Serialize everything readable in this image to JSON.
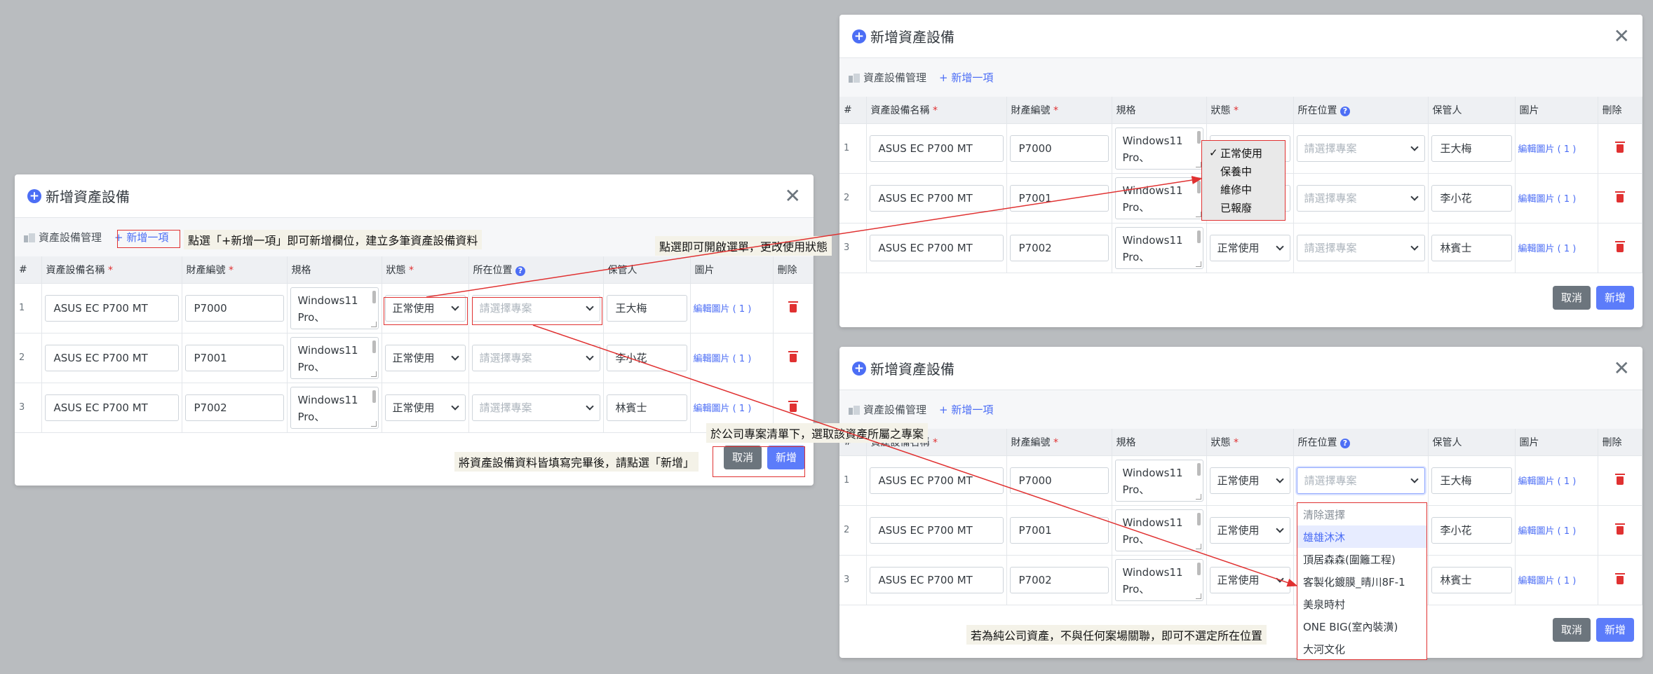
{
  "dialog": {
    "title": "新增資產設備",
    "breadcrumb": "資產設備管理",
    "add_item": "+ 新增一項",
    "columns": {
      "idx": "#",
      "name": "資產設備名稱",
      "code": "財產編號",
      "spec": "規格",
      "status": "狀態",
      "location": "所在位置",
      "keeper": "保管人",
      "image": "圖片",
      "delete": "刪除"
    },
    "required_mark": "*",
    "help_icon_glyph": "?",
    "location_placeholder": "請選擇專案",
    "rows": [
      {
        "idx": "1",
        "name": "ASUS EC P700 MT",
        "code": "P7000",
        "spec_line1": "Windows11",
        "spec_line2": "Pro、",
        "status": "正常使用",
        "keeper": "王大梅",
        "image": "編輯圖片 ( 1 )"
      },
      {
        "idx": "2",
        "name": "ASUS EC P700 MT",
        "code": "P7001",
        "spec_line1": "Windows11",
        "spec_line2": "Pro、",
        "status": "正常使用",
        "keeper": "李小花",
        "image": "編輯圖片 ( 1 )"
      },
      {
        "idx": "3",
        "name": "ASUS EC P700 MT",
        "code": "P7002",
        "spec_line1": "Windows11",
        "spec_line2": "Pro、",
        "status": "正常使用",
        "keeper": "林賓士",
        "image": "編輯圖片 ( 1 )"
      }
    ],
    "cancel_label": "取消",
    "submit_label": "新增"
  },
  "status_options": [
    "正常使用",
    "保養中",
    "維修中",
    "已報廢"
  ],
  "status_check": "✓",
  "location_options": [
    "清除選擇",
    "雄雄沐沐",
    "頂居森森(圍籬工程)",
    "客製化鍍膜_晴川8F-1",
    "美泉時村",
    "ONE BIG(室內裝潢)",
    "大河文化"
  ],
  "callouts": {
    "add_item": "點選「+新增一項」即可新增欄位，建立多筆資產設備資料",
    "status": "點選即可開啟選單，更改使用狀態",
    "location": "於公司專案清單下，選取該資產所屬之專案",
    "submit": "將資產設備資料皆填寫完畢後，請點選「新增」",
    "no_location": "若為純公司資產，不與任何案場關聯，即可不選定所在位置"
  },
  "colors": {
    "accent": "#4c6ef5",
    "annotation_red": "#e03131",
    "backdrop": "#b9bcbf"
  }
}
